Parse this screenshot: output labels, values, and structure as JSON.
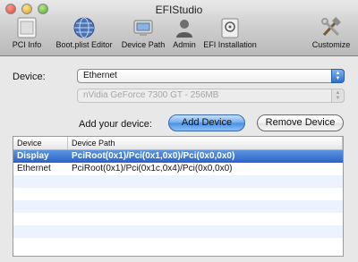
{
  "window": {
    "title": "EFIStudio"
  },
  "toolbar": {
    "items": [
      {
        "label": "PCI Info",
        "icon": "pci-info-icon"
      },
      {
        "label": "Boot.plist Editor",
        "icon": "globe-icon"
      },
      {
        "label": "Device Path",
        "icon": "device-path-icon"
      },
      {
        "label": "Admin",
        "icon": "admin-user-icon"
      },
      {
        "label": "EFI Installation",
        "icon": "efi-installation-icon"
      },
      {
        "label": "Customize",
        "icon": "tools-icon"
      }
    ]
  },
  "form": {
    "device_label": "Device:",
    "device_value": "Ethernet",
    "gpu_value": "nVidia GeForce 7300 GT - 256MB",
    "add_label": "Add your device:",
    "add_button": "Add Device",
    "remove_button": "Remove Device"
  },
  "table": {
    "headers": [
      "Device",
      "Device Path"
    ],
    "rows": [
      {
        "device": "Display",
        "path": "PciRoot(0x1)/Pci(0x1,0x0)/Pci(0x0,0x0)",
        "selected": true
      },
      {
        "device": "Ethernet",
        "path": "PciRoot(0x1)/Pci(0x1c,0x4)/Pci(0x0,0x0)",
        "selected": false
      }
    ]
  },
  "colors": {
    "selection": "#2a63c8",
    "accent_button": "#6da9ee"
  }
}
